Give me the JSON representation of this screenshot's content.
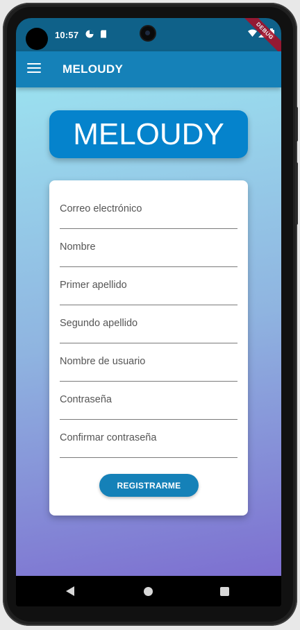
{
  "status_bar": {
    "time": "10:57",
    "debug_label": "DEBUG"
  },
  "app_bar": {
    "title": "MELOUDY",
    "menu_icon": "hamburger-menu-icon"
  },
  "logo": {
    "text": "MELOUDY",
    "color": "#0583cc"
  },
  "form": {
    "fields": [
      {
        "placeholder": "Correo electrónico",
        "value": ""
      },
      {
        "placeholder": "Nombre",
        "value": ""
      },
      {
        "placeholder": "Primer apellido",
        "value": ""
      },
      {
        "placeholder": "Segundo apellido",
        "value": ""
      },
      {
        "placeholder": "Nombre de usuario",
        "value": ""
      },
      {
        "placeholder": "Contraseña",
        "value": ""
      },
      {
        "placeholder": "Confirmar contraseña",
        "value": ""
      }
    ],
    "submit_label": "REGISTRARME"
  },
  "nav_bar": {
    "icons": [
      "back-icon",
      "home-icon",
      "recents-icon"
    ]
  },
  "colors": {
    "app_bar": "#1581b8",
    "status_bar": "#0f6189",
    "button": "#1581b8"
  }
}
